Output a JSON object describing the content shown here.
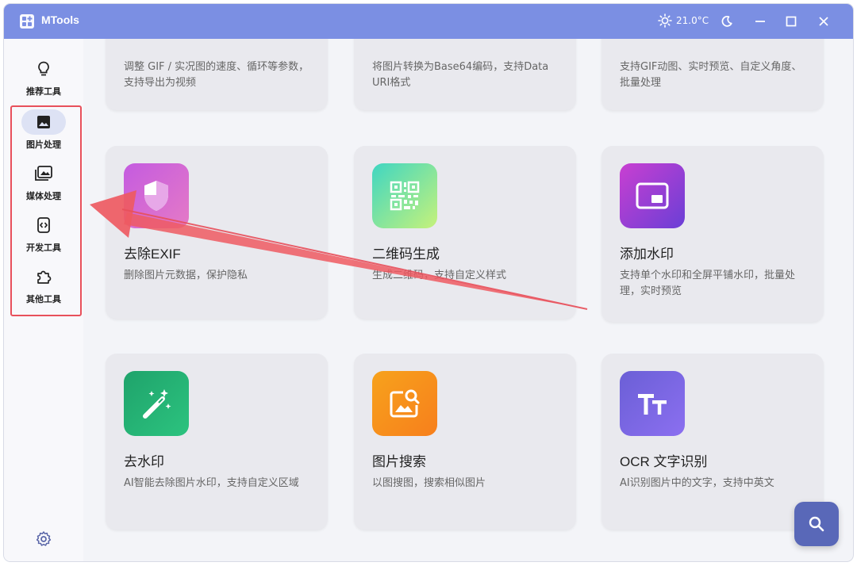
{
  "titlebar": {
    "title": "MTools",
    "temperature": "21.0°C"
  },
  "sidebar": {
    "items": [
      {
        "label": "推荐工具",
        "icon": "lightbulb-icon"
      },
      {
        "label": "图片处理",
        "icon": "image-icon",
        "active": true
      },
      {
        "label": "媒体处理",
        "icon": "media-icon"
      },
      {
        "label": "开发工具",
        "icon": "code-icon"
      },
      {
        "label": "其他工具",
        "icon": "puzzle-icon"
      }
    ],
    "settings_icon": "gear-icon"
  },
  "cards_top": [
    {
      "desc": "调整 GIF / 实况图的速度、循环等参数，支持导出为视频"
    },
    {
      "desc": "将图片转换为Base64编码，支持Data URI格式"
    },
    {
      "desc": "支持GIF动图、实时预览、自定义角度、批量处理"
    }
  ],
  "cards": [
    {
      "title": "去除EXIF",
      "desc": "删除图片元数据，保护隐私",
      "icon": "shield-icon",
      "color_from": "#c45be0",
      "color_to": "#e57ac6"
    },
    {
      "title": "二维码生成",
      "desc": "生成二维码，支持自定义样式",
      "icon": "qrcode-icon",
      "color_from": "#3fd6c2",
      "color_to": "#c6f27a"
    },
    {
      "title": "添加水印",
      "desc": "支持单个水印和全屏平铺水印，批量处理，实时预览",
      "icon": "watermark-icon",
      "color_from": "#c93fd1",
      "color_to": "#6a3fd6"
    },
    {
      "title": "去水印",
      "desc": "AI智能去除图片水印，支持自定义区域",
      "icon": "magic-wand-icon",
      "color_from": "#1fa36b",
      "color_to": "#2cc37f"
    },
    {
      "title": "图片搜索",
      "desc": "以图搜图，搜索相似图片",
      "icon": "image-search-icon",
      "color_from": "#f7a21c",
      "color_to": "#f77f1c"
    },
    {
      "title": "OCR 文字识别",
      "desc": "AI识别图片中的文字，支持中英文",
      "icon": "text-icon",
      "color_from": "#6b5fd6",
      "color_to": "#8b6ff0"
    }
  ],
  "fab": {
    "icon": "search-icon"
  },
  "colors": {
    "titlebar": "#7b8fe3",
    "highlight": "#e8505b",
    "fab": "#5968b8"
  }
}
